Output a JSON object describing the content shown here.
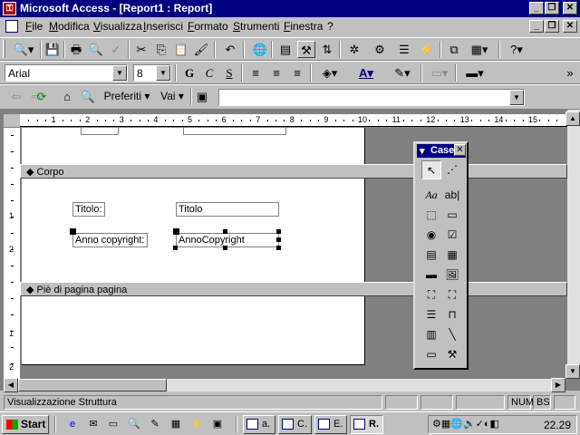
{
  "window": {
    "title": "Microsoft Access - [Report1 : Report]",
    "app_icon": "access-key-icon",
    "controls": [
      "_",
      "❐",
      "✕"
    ]
  },
  "menu": {
    "items": [
      "File",
      "Modifica",
      "Visualizza",
      "Inserisci",
      "Formato",
      "Strumenti",
      "Finestra",
      "?"
    ]
  },
  "format_bar": {
    "font": "Arial",
    "size": "8",
    "bold": "G",
    "italic": "C",
    "underline": "S"
  },
  "web_bar": {
    "favorites": "Preferiti ▾",
    "go": "Vai ▾",
    "address": ""
  },
  "report": {
    "body_section": "Corpo",
    "footer_section": "Piè di pagina pagina",
    "title_label": "Titolo:",
    "title_field": "Titolo",
    "copyright_label": "Anno copyright:",
    "copyright_field": "AnnoCopyright",
    "ruler_marks": [
      "1",
      "2",
      "3",
      "4",
      "5",
      "6",
      "7",
      "8",
      "9",
      "10",
      "11",
      "12",
      "13",
      "14",
      "15"
    ],
    "vruler_marks": [
      "1",
      "2",
      "1",
      "2"
    ]
  },
  "toolbox": {
    "title": "Case",
    "tools": [
      "select-pointer",
      "control-wizard",
      "label",
      "textbox",
      "option-group",
      "toggle-button",
      "option-button",
      "checkbox",
      "combo-box",
      "list-box",
      "command-button",
      "image",
      "unbound-object",
      "bound-object",
      "page-break",
      "tab-control",
      "subform",
      "line",
      "rectangle",
      "more-controls"
    ]
  },
  "status": {
    "text": "Visualizzazione Struttura",
    "num": "NUM",
    "bs": "BS"
  },
  "taskbar": {
    "start": "Start",
    "tasks": [
      "a.",
      "C.",
      "E.",
      "R."
    ],
    "clock": "22.29"
  }
}
